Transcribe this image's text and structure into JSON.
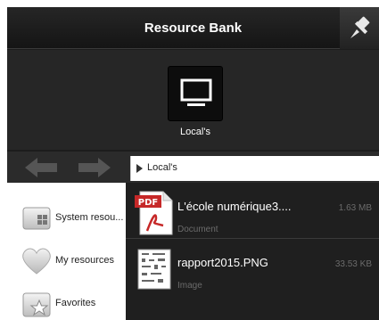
{
  "window": {
    "title": "Resource Bank"
  },
  "location_tile": {
    "label": "Local's"
  },
  "path_bar": {
    "path": "Local's"
  },
  "sidebar": {
    "items": [
      {
        "label": "System resou...",
        "icon": "system-resources-icon"
      },
      {
        "label": "My resources",
        "icon": "heart-icon"
      },
      {
        "label": "Favorites",
        "icon": "star-icon"
      }
    ]
  },
  "files": [
    {
      "name": "L'école numérique3....",
      "type": "Document",
      "size": "1.63 MB",
      "icon": "pdf-icon"
    },
    {
      "name": "rapport2015.PNG",
      "type": "Image",
      "size": "33.53 KB",
      "icon": "image-thumbnail"
    }
  ]
}
